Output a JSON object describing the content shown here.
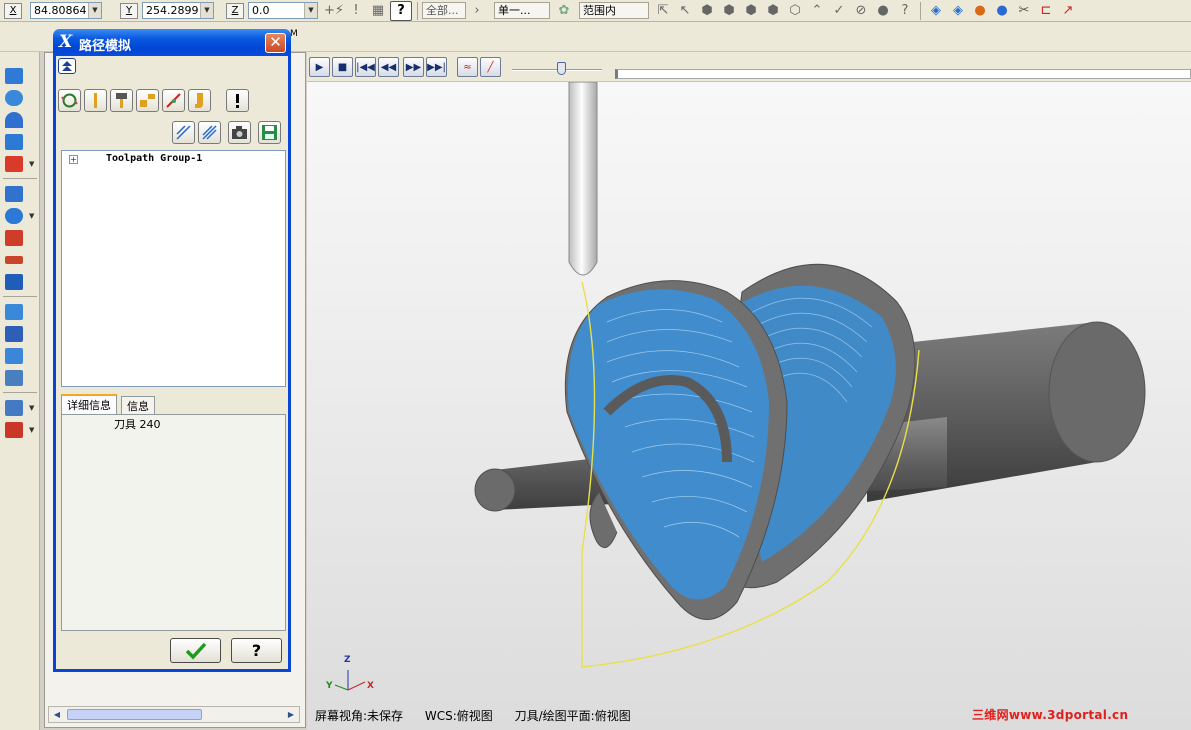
{
  "coordinates": {
    "x_label": "X",
    "x_value": "84.80864",
    "y_label": "Y",
    "y_value": "254.2899",
    "z_label": "Z",
    "z_value": "0.0"
  },
  "selection_toolbar": {
    "filter_all": "全部...",
    "filter_single": "单一...",
    "filter_range": "范围内",
    "help_icon": "question-mark-icon"
  },
  "simulation_controls": {
    "buttons": [
      "play",
      "stop",
      "to-start",
      "step-back",
      "step-forward",
      "to-end",
      "toolpath-display",
      "tool-display"
    ],
    "speed_slider_level": 0.55
  },
  "dialog": {
    "title": "路径模拟",
    "collapse_icon": "double-chevron-up-icon",
    "tree": {
      "root_label": "Toolpath Group-1"
    },
    "tabs": [
      "详细信息",
      "信息"
    ],
    "active_tab": 0,
    "info_text": "刀具 240",
    "ok_icon": "checkmark-icon",
    "help_label": "?"
  },
  "viewport": {
    "axis_labels": {
      "z": "Z",
      "y": "Y",
      "x": "X"
    }
  },
  "status_bar": {
    "view": "屏幕视角:未保存",
    "wcs": "WCS:俯视图",
    "plane": "刀具/绘图平面:俯视图"
  },
  "watermark": "三维网www.3dportal.cn",
  "colors": {
    "titlebar": "#0046d4",
    "toolpath": "#3a8fd8",
    "arc_path": "#e8e04a",
    "part_gray": "#6f6f6f"
  }
}
